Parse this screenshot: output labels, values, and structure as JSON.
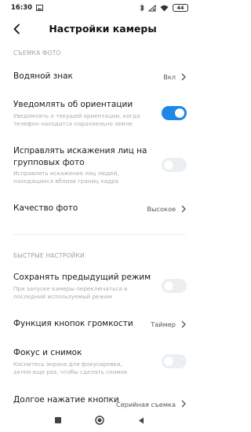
{
  "status_bar": {
    "time": "16:30",
    "battery": "44",
    "icons": [
      "image-icon",
      "bluetooth-icon",
      "signal-off-icon",
      "wifi-icon",
      "battery-icon"
    ]
  },
  "header": {
    "title": "Настройки камеры",
    "back_icon": "back-arrow-icon"
  },
  "sections": {
    "photo": "СЪЕМКА ФОТО",
    "quick": "БЫСТРЫЕ НАСТРОЙКИ"
  },
  "settings": {
    "watermark": {
      "title": "Водяной знак",
      "value": "Вкл"
    },
    "orientation": {
      "title": "Уведомлять об ориентации",
      "sub1": "Уведомлять о текущей ориентации, когда",
      "sub2": "телефон находится параллельно земле",
      "enabled": true
    },
    "face_distortion": {
      "title1": "Исправлять искажения лиц на",
      "title2": "групповых фото",
      "sub1": "Исправлять искажения лиц людей,",
      "sub2": "находящихся вблизи границ кадра",
      "enabled": false
    },
    "photo_quality": {
      "title": "Качество фото",
      "value": "Высокое"
    },
    "save_mode": {
      "title": "Сохранять предыдущий режим",
      "sub1": "При запуске камеры переключаться в",
      "sub2": "последний используемый режим",
      "enabled": false
    },
    "volume_keys": {
      "title": "Функция кнопок громкости",
      "value": "Таймер"
    },
    "focus_shot": {
      "title": "Фокус и снимок",
      "sub1": "Коснитесь экрана для фокусировки,",
      "sub2": "затем еще раз, чтобы сделать снимок",
      "enabled": false
    },
    "long_press": {
      "title": "Долгое нажатие кнопки",
      "value": "Серийная съемка"
    }
  },
  "nav": {
    "icons": [
      "recents-icon",
      "home-icon",
      "back-icon"
    ]
  },
  "colors": {
    "accent": "#1f87e6",
    "section": "#9aa3ad",
    "subtitle": "#a7acb2"
  }
}
